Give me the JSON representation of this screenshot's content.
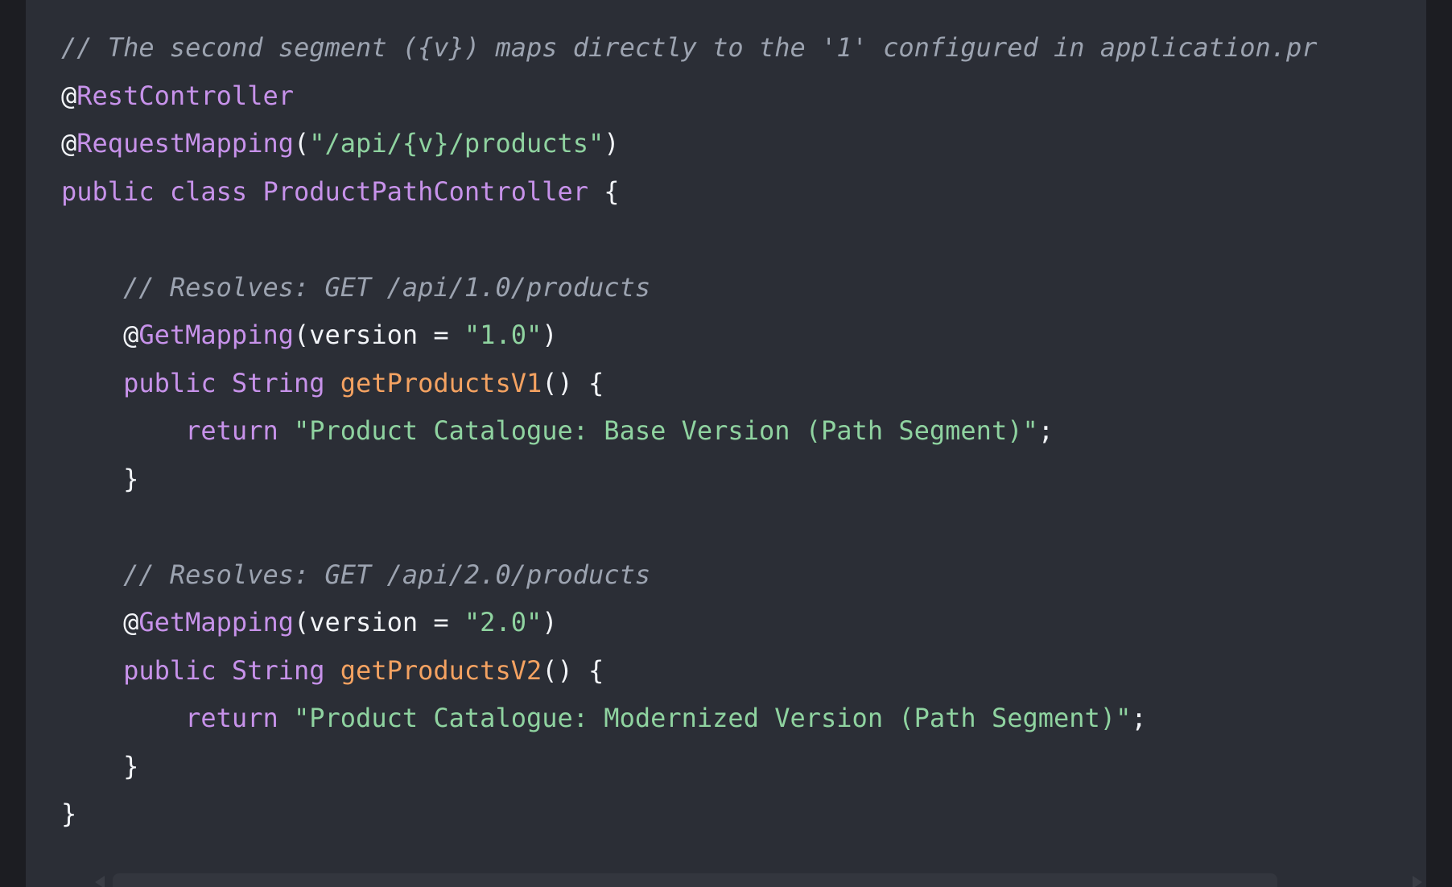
{
  "code_lines": [
    {
      "tokens": [
        {
          "type": "cm",
          "text": "// The second segment ({v}) maps directly to the '1' configured in application.pr"
        }
      ]
    },
    {
      "tokens": [
        {
          "type": "plain",
          "text": "@"
        },
        {
          "type": "an",
          "text": "RestController"
        }
      ]
    },
    {
      "tokens": [
        {
          "type": "plain",
          "text": "@"
        },
        {
          "type": "an",
          "text": "RequestMapping"
        },
        {
          "type": "plain",
          "text": "("
        },
        {
          "type": "str",
          "text": "\"/api/{v}/products\""
        },
        {
          "type": "plain",
          "text": ")"
        }
      ]
    },
    {
      "tokens": [
        {
          "type": "kw",
          "text": "public"
        },
        {
          "type": "plain",
          "text": " "
        },
        {
          "type": "kw",
          "text": "class"
        },
        {
          "type": "plain",
          "text": " "
        },
        {
          "type": "ty",
          "text": "ProductPathController"
        },
        {
          "type": "plain",
          "text": " {"
        }
      ]
    },
    {
      "tokens": []
    },
    {
      "tokens": [
        {
          "type": "plain",
          "text": "    "
        },
        {
          "type": "cm",
          "text": "// Resolves: GET /api/1.0/products"
        }
      ]
    },
    {
      "tokens": [
        {
          "type": "plain",
          "text": "    @"
        },
        {
          "type": "an",
          "text": "GetMapping"
        },
        {
          "type": "plain",
          "text": "(version = "
        },
        {
          "type": "str",
          "text": "\"1.0\""
        },
        {
          "type": "plain",
          "text": ")"
        }
      ]
    },
    {
      "tokens": [
        {
          "type": "plain",
          "text": "    "
        },
        {
          "type": "kw",
          "text": "public"
        },
        {
          "type": "plain",
          "text": " "
        },
        {
          "type": "ty",
          "text": "String"
        },
        {
          "type": "plain",
          "text": " "
        },
        {
          "type": "fn",
          "text": "getProductsV1"
        },
        {
          "type": "plain",
          "text": "() {"
        }
      ]
    },
    {
      "tokens": [
        {
          "type": "plain",
          "text": "        "
        },
        {
          "type": "kw",
          "text": "return"
        },
        {
          "type": "plain",
          "text": " "
        },
        {
          "type": "str",
          "text": "\"Product Catalogue: Base Version (Path Segment)\""
        },
        {
          "type": "plain",
          "text": ";"
        }
      ]
    },
    {
      "tokens": [
        {
          "type": "plain",
          "text": "    }"
        }
      ]
    },
    {
      "tokens": []
    },
    {
      "tokens": [
        {
          "type": "plain",
          "text": "    "
        },
        {
          "type": "cm",
          "text": "// Resolves: GET /api/2.0/products"
        }
      ]
    },
    {
      "tokens": [
        {
          "type": "plain",
          "text": "    @"
        },
        {
          "type": "an",
          "text": "GetMapping"
        },
        {
          "type": "plain",
          "text": "(version = "
        },
        {
          "type": "str",
          "text": "\"2.0\""
        },
        {
          "type": "plain",
          "text": ")"
        }
      ]
    },
    {
      "tokens": [
        {
          "type": "plain",
          "text": "    "
        },
        {
          "type": "kw",
          "text": "public"
        },
        {
          "type": "plain",
          "text": " "
        },
        {
          "type": "ty",
          "text": "String"
        },
        {
          "type": "plain",
          "text": " "
        },
        {
          "type": "fn",
          "text": "getProductsV2"
        },
        {
          "type": "plain",
          "text": "() {"
        }
      ]
    },
    {
      "tokens": [
        {
          "type": "plain",
          "text": "        "
        },
        {
          "type": "kw",
          "text": "return"
        },
        {
          "type": "plain",
          "text": " "
        },
        {
          "type": "str",
          "text": "\"Product Catalogue: Modernized Version (Path Segment)\""
        },
        {
          "type": "plain",
          "text": ";"
        }
      ]
    },
    {
      "tokens": [
        {
          "type": "plain",
          "text": "    }"
        }
      ]
    },
    {
      "tokens": [
        {
          "type": "plain",
          "text": "}"
        }
      ]
    }
  ],
  "colors": {
    "page_background": "#1c1d22",
    "panel_background": "#2b2e36",
    "comment": "#9ca3b0",
    "keyword": "#c792ea",
    "string": "#8fd3a0",
    "method": "#f4a261",
    "text": "#f2f4f8"
  }
}
